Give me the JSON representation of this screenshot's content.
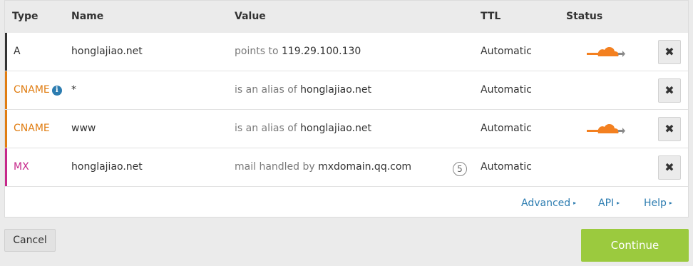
{
  "header": {
    "type": "Type",
    "name": "Name",
    "value": "Value",
    "ttl": "TTL",
    "status": "Status"
  },
  "records": [
    {
      "type": "A",
      "name": "honglajiao.net",
      "value_prefix": "points to",
      "value": "119.29.100.130",
      "ttl": "Automatic",
      "proxied": true
    },
    {
      "type": "CNAME",
      "name": "*",
      "value_prefix": "is an alias of",
      "value": "honglajiao.net",
      "ttl": "Automatic",
      "proxied": false,
      "info_icon": "info-icon"
    },
    {
      "type": "CNAME",
      "name": "www",
      "value_prefix": "is an alias of",
      "value": "honglajiao.net",
      "ttl": "Automatic",
      "proxied": true
    },
    {
      "type": "MX",
      "name": "honglajiao.net",
      "value_prefix": "mail handled by",
      "value": "mxdomain.qq.com",
      "priority": "5",
      "ttl": "Automatic",
      "proxied": false
    }
  ],
  "delete_glyph": "✖",
  "info_glyph": "i",
  "links": {
    "advanced": "Advanced",
    "api": "API",
    "help": "Help",
    "caret": "▸"
  },
  "buttons": {
    "cancel": "Cancel",
    "continue": "Continue"
  },
  "colors": {
    "a": "#333333",
    "cname": "#e07d12",
    "mx": "#c6288a",
    "cloud": "#f38020",
    "link": "#2c7cb0",
    "continue_bg": "#9bca3e"
  }
}
